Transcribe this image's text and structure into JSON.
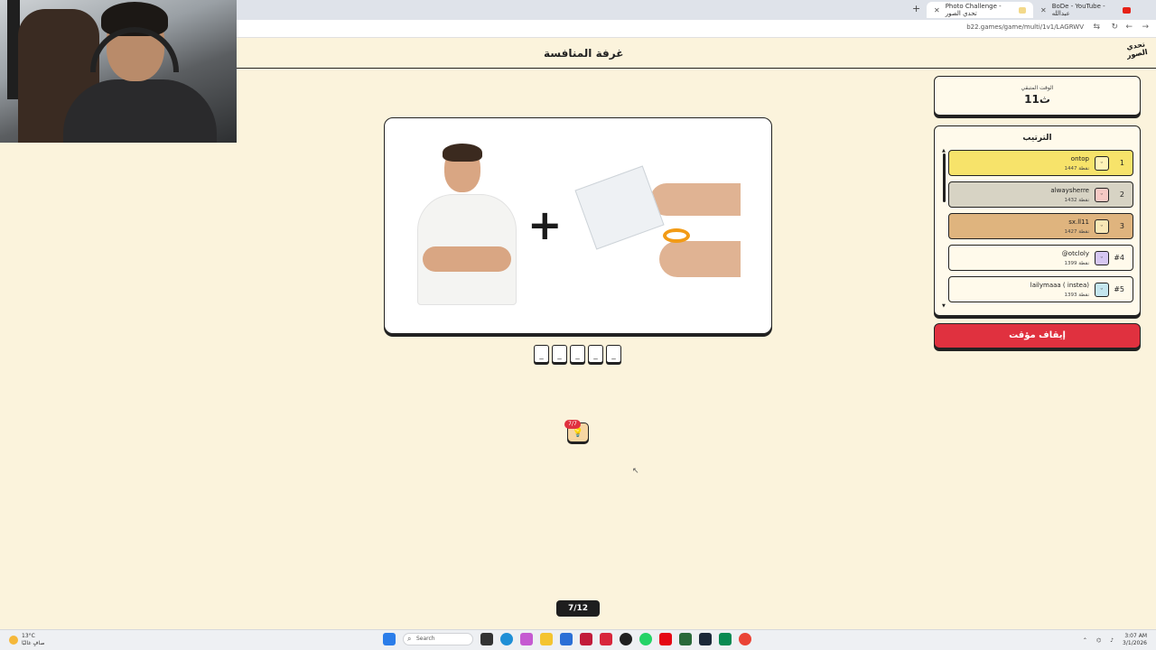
{
  "browser": {
    "tabs": [
      {
        "label": "Photo Challenge - تحدي الصور",
        "active": true
      },
      {
        "label": "BoDe - YouTube - عبدالله",
        "active": false
      }
    ],
    "url": "b22.games/game/multi/1v1/LAGRWV"
  },
  "header": {
    "room_title": "غرفة المنافسة",
    "logo_text": "تحدي الصور"
  },
  "timer": {
    "label": "الوقت المتبقي",
    "value": "11ث"
  },
  "ranking": {
    "title": "الترتيب",
    "players": [
      {
        "rank": "1",
        "name": "ontop",
        "score": "1447 نقطة",
        "color": "#f7e36a"
      },
      {
        "rank": "2",
        "name": "alwaysherre",
        "score": "1432 نقطة",
        "color": "#d7d3c4"
      },
      {
        "rank": "3",
        "name": "sx.ll11",
        "score": "1427 نقطة",
        "color": "#dfb47e"
      },
      {
        "rank": "#4",
        "name": "@otcloly",
        "score": "1399 نقطة",
        "color": "#fffaeb"
      },
      {
        "rank": "#5",
        "name": "lailymaaa ( instea)",
        "score": "1393 نقطة",
        "color": "#fffaeb"
      }
    ]
  },
  "pause_button": {
    "label": "إيقاف مؤقت"
  },
  "answer_slots": [
    "_",
    "_",
    "_",
    "_",
    "_"
  ],
  "hint": {
    "badge": "7/7",
    "icon": "lightbulb-icon"
  },
  "progress": {
    "label": "7/12"
  },
  "taskbar": {
    "weather_temp": "13°C",
    "weather_text": "صافٍ غالبًا",
    "search_placeholder": "Search",
    "time": "3:07 AM",
    "date": "3/1/2026"
  }
}
